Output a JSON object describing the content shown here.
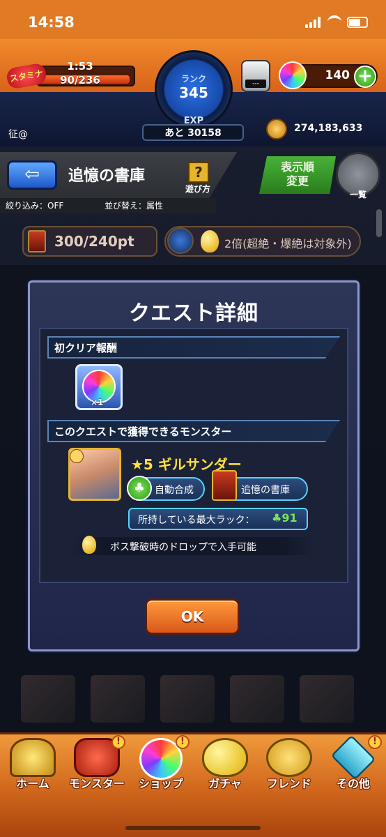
{
  "status": {
    "time": "14:58"
  },
  "header": {
    "stamina_label": "スタミナ",
    "stamina_timer": "1:53",
    "stamina_value": "90/236",
    "rank_label": "ランク",
    "rank_value": "345",
    "exp_label": "EXP",
    "exp_remaining": "あと 30158",
    "orb_machine_screen": "---",
    "orb_count": "140",
    "orb_plus": "+",
    "coin_count": "274,183,633",
    "user_name": "征@"
  },
  "subheader": {
    "back_arrow": "⇦",
    "title": "追憶の書庫",
    "help_icon": "?",
    "help_label": "遊び方",
    "filter_label": "絞り込み：OFF",
    "sort_label": "並び替え：属性",
    "display_order_line1": "表示順",
    "display_order_line2": "変更",
    "list_label": "一覧"
  },
  "points": {
    "value": "300/240pt",
    "bonus": "2倍(超絶・爆絶は対象外)"
  },
  "modal": {
    "title": "クエスト詳細",
    "first_clear_title": "初クリア報酬",
    "reward_qty": "×1",
    "monsters_title": "このクエストで獲得できるモンスター",
    "monster_name": "★5 ギルサンダー",
    "auto_fusion_label": "自動合成",
    "auto_fusion_icon": "♣",
    "library_label": "追憶の書庫",
    "max_luck_label": "所持している最大ラック：",
    "max_luck_value": "♣91",
    "drop_label": "ボス撃破時のドロップで入手可能",
    "ok_label": "OK"
  },
  "nav": {
    "home": "ホーム",
    "monster": "モンスター",
    "shop": "ショップ",
    "gacha": "ガチャ",
    "friend": "フレンド",
    "other": "その他",
    "badge": "!"
  },
  "colors": {
    "accent_orange": "#e07a25",
    "gold_text": "#ffe23b",
    "luck_green": "#7ce35a"
  }
}
